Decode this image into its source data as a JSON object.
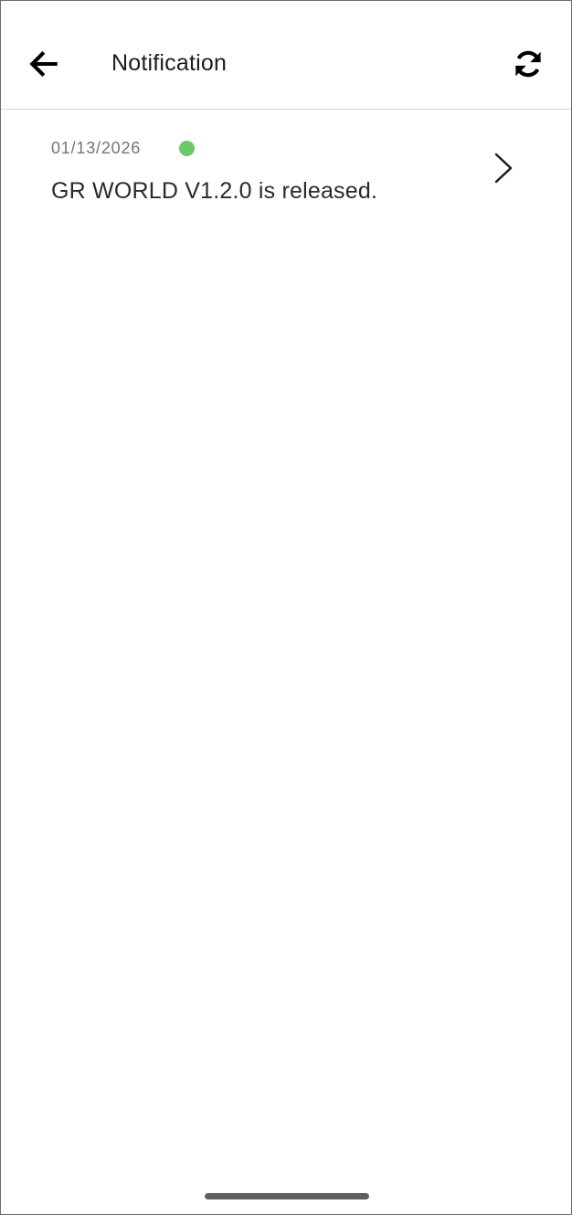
{
  "header": {
    "title": "Notification",
    "back_icon": "arrow-left-icon",
    "refresh_icon": "refresh-icon"
  },
  "notifications": [
    {
      "date": "01/13/2026",
      "unread": true,
      "message": "GR WORLD V1.2.0 is released.",
      "chevron_icon": "chevron-right-icon"
    }
  ],
  "colors": {
    "unread_dot": "#6cc96a",
    "divider": "#d9d9d9",
    "home_indicator": "#5f5f5f"
  }
}
